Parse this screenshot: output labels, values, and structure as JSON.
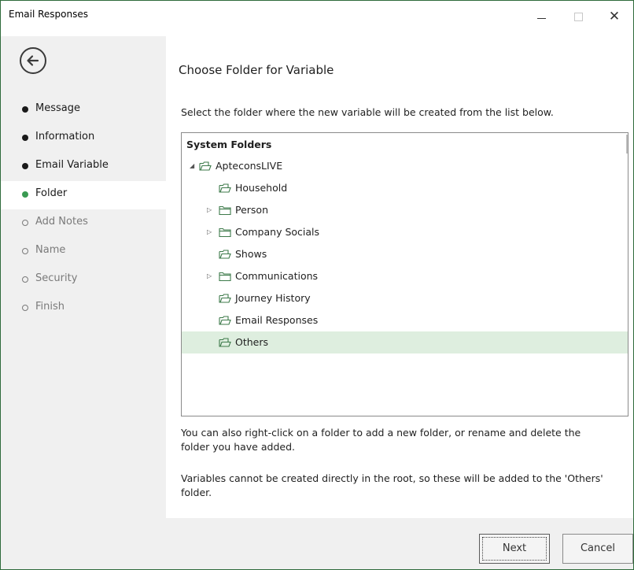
{
  "window": {
    "title": "Email Responses",
    "minimize": "−",
    "maximize": "",
    "close": "✕"
  },
  "sidebar": {
    "back_icon": "arrow-left-circle-icon",
    "steps": [
      {
        "label": "Message",
        "state": "done"
      },
      {
        "label": "Information",
        "state": "done"
      },
      {
        "label": "Email Variable",
        "state": "done"
      },
      {
        "label": "Folder",
        "state": "current"
      },
      {
        "label": "Add Notes",
        "state": "todo"
      },
      {
        "label": "Name",
        "state": "todo"
      },
      {
        "label": "Security",
        "state": "todo"
      },
      {
        "label": "Finish",
        "state": "todo"
      }
    ]
  },
  "main": {
    "heading": "Choose Folder for Variable",
    "instruction": "Select the folder where the new variable will be created from the list below.",
    "tree": {
      "root_label": "System Folders",
      "nodes": [
        {
          "label": "ApteconsLIVE",
          "expander": "expanded",
          "icon": "folder-open-icon"
        },
        {
          "label": "Household",
          "expander": "none",
          "icon": "folder-open-icon"
        },
        {
          "label": "Person",
          "expander": "collapsed",
          "icon": "folder-closed-icon"
        },
        {
          "label": "Company Socials",
          "expander": "collapsed",
          "icon": "folder-closed-icon"
        },
        {
          "label": "Shows",
          "expander": "none",
          "icon": "folder-open-icon"
        },
        {
          "label": "Communications",
          "expander": "collapsed",
          "icon": "folder-closed-icon"
        },
        {
          "label": "Journey History",
          "expander": "none",
          "icon": "folder-open-icon"
        },
        {
          "label": "Email Responses",
          "expander": "none",
          "icon": "folder-open-icon"
        },
        {
          "label": "Others",
          "expander": "none",
          "icon": "folder-open-icon",
          "selected": true
        }
      ]
    },
    "note1_line1": "You can also right-click on a folder to add a new folder, or rename and delete the",
    "note1_line2": "folder you have added.",
    "note2_line1": "Variables cannot be created directly in the root, so these will be added to the 'Others'",
    "note2_line2": "folder."
  },
  "footer": {
    "next_label": "Next",
    "cancel_label": "Cancel"
  },
  "colors": {
    "accent_green": "#3a9a52",
    "selection_bg": "#deeedf",
    "folder_stroke": "#3d7a4a"
  }
}
